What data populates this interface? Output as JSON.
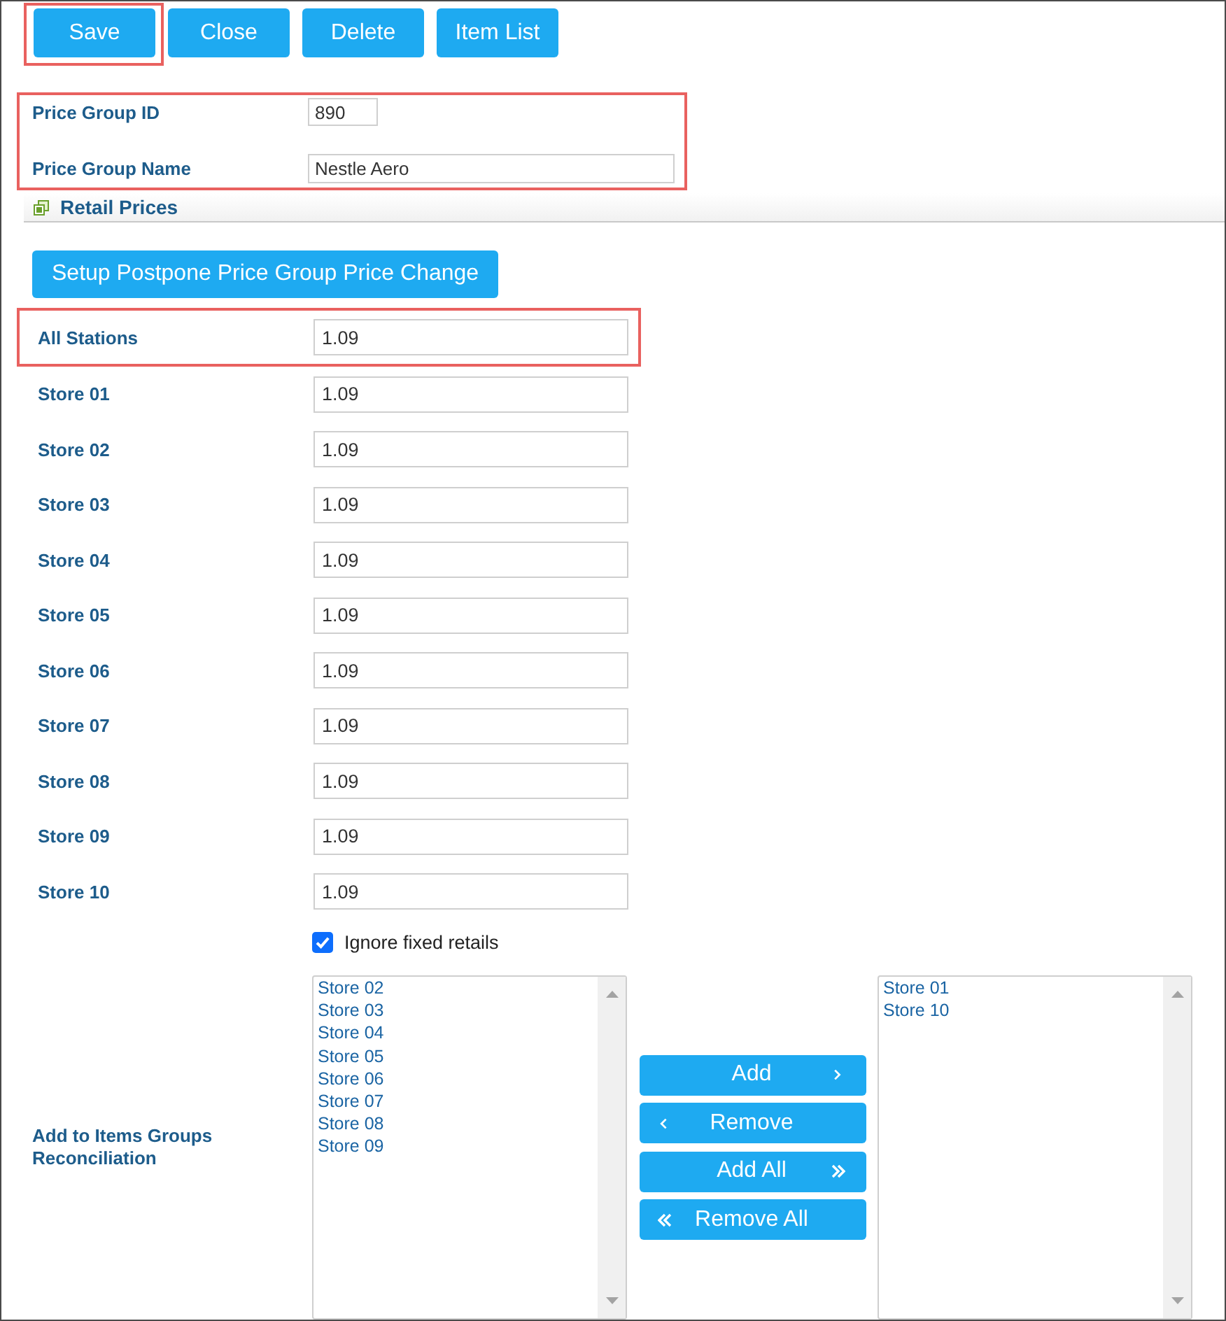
{
  "toolbar": {
    "buttons": [
      {
        "label": "Save",
        "highlighted": true
      },
      {
        "label": "Close",
        "highlighted": false
      },
      {
        "label": "Delete",
        "highlighted": false
      },
      {
        "label": "Item List",
        "highlighted": false
      }
    ]
  },
  "header_fields": {
    "highlighted": true,
    "fields": [
      {
        "label": "Price Group ID",
        "value": "890",
        "kind": "short"
      },
      {
        "label": "Price Group Name",
        "value": "Nestle Aero",
        "kind": "long"
      }
    ]
  },
  "section": {
    "title": "Retail Prices"
  },
  "setup_button": {
    "label": "Setup Postpone Price Group Price Change"
  },
  "prices": [
    {
      "label": "All Stations",
      "value": "1.09",
      "highlighted": true
    },
    {
      "label": "Store 01",
      "value": "1.09",
      "highlighted": false
    },
    {
      "label": "Store 02",
      "value": "1.09",
      "highlighted": false
    },
    {
      "label": "Store 03",
      "value": "1.09",
      "highlighted": false
    },
    {
      "label": "Store 04",
      "value": "1.09",
      "highlighted": false
    },
    {
      "label": "Store 05",
      "value": "1.09",
      "highlighted": false
    },
    {
      "label": "Store 06",
      "value": "1.09",
      "highlighted": false
    },
    {
      "label": "Store 07",
      "value": "1.09",
      "highlighted": false
    },
    {
      "label": "Store 08",
      "value": "1.09",
      "highlighted": false
    },
    {
      "label": "Store 09",
      "value": "1.09",
      "highlighted": false
    },
    {
      "label": "Store 10",
      "value": "1.09",
      "highlighted": false
    }
  ],
  "ignore_fixed_retails": {
    "label": "Ignore fixed retails",
    "checked": true
  },
  "reconciliation": {
    "label": "Add to Items Groups Reconciliation",
    "available": [
      "Store 02",
      "Store 03",
      "Store 04",
      "Store 05",
      "Store 06",
      "Store 07",
      "Store 08",
      "Store 09"
    ],
    "chosen": [
      "Store 01",
      "Store 10"
    ],
    "buttons": [
      {
        "label": "Add",
        "kind": "add"
      },
      {
        "label": "Remove",
        "kind": "remove"
      },
      {
        "label": "Add All",
        "kind": "add-all"
      },
      {
        "label": "Remove All",
        "kind": "remove-all"
      }
    ]
  }
}
